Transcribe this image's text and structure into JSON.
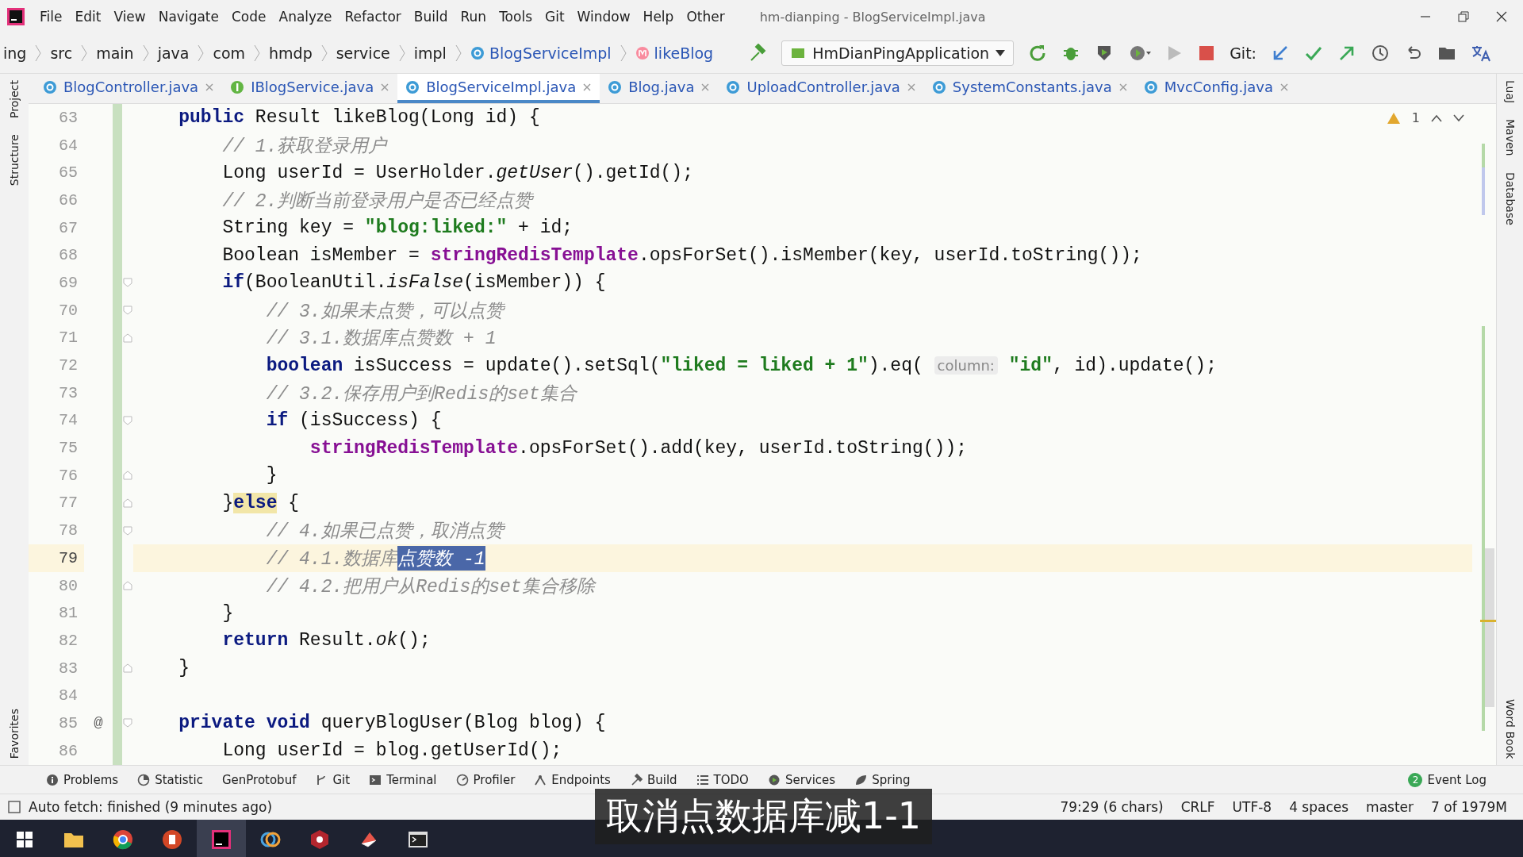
{
  "title_bar": {
    "menu": [
      "File",
      "Edit",
      "View",
      "Navigate",
      "Code",
      "Analyze",
      "Refactor",
      "Build",
      "Run",
      "Tools",
      "Git",
      "Window",
      "Help",
      "Other"
    ],
    "title": "hm-dianping - BlogServiceImpl.java"
  },
  "nav_bar": {
    "breadcrumbs": [
      {
        "text": "ing",
        "kind": "folder"
      },
      {
        "text": "src",
        "kind": "folder"
      },
      {
        "text": "main",
        "kind": "folder"
      },
      {
        "text": "java",
        "kind": "folder"
      },
      {
        "text": "com",
        "kind": "folder"
      },
      {
        "text": "hmdp",
        "kind": "folder"
      },
      {
        "text": "service",
        "kind": "folder"
      },
      {
        "text": "impl",
        "kind": "folder"
      },
      {
        "text": "BlogServiceImpl",
        "kind": "class"
      },
      {
        "text": "likeBlog",
        "kind": "method"
      }
    ],
    "run_config": "HmDianPingApplication",
    "git_label": "Git:"
  },
  "tabs": [
    {
      "label": "BlogController.java",
      "kind": "class",
      "selected": false
    },
    {
      "label": "IBlogService.java",
      "kind": "interface",
      "selected": false
    },
    {
      "label": "BlogServiceImpl.java",
      "kind": "class",
      "selected": true
    },
    {
      "label": "Blog.java",
      "kind": "class",
      "selected": false
    },
    {
      "label": "UploadController.java",
      "kind": "class",
      "selected": false
    },
    {
      "label": "SystemConstants.java",
      "kind": "class",
      "selected": false
    },
    {
      "label": "MvcConfig.java",
      "kind": "class",
      "selected": false
    }
  ],
  "left_strip": {
    "top": [
      "Project",
      "Structure"
    ],
    "bottom": [
      "Favorites"
    ]
  },
  "right_strip": {
    "top": [
      "LuaJ",
      "Maven",
      "Database"
    ],
    "bottom": [
      "Word Book"
    ]
  },
  "editor": {
    "warning_count": "1",
    "lines": [
      {
        "number": "63",
        "kind": "plain",
        "current": false,
        "tokens": [
          {
            "kind": "keyword",
            "text": "    public "
          },
          {
            "kind": "plain",
            "text": "Result likeBlog(Long id) {"
          }
        ]
      },
      {
        "number": "64",
        "kind": "plain",
        "current": false,
        "tokens": [
          {
            "kind": "comment",
            "text": "        // 1.获取登录用户"
          }
        ]
      },
      {
        "number": "65",
        "kind": "plain",
        "current": false,
        "tokens": [
          {
            "kind": "plain",
            "text": "        Long userId = UserHolder."
          },
          {
            "kind": "italic",
            "text": "getUser"
          },
          {
            "kind": "plain",
            "text": "().getId();"
          }
        ]
      },
      {
        "number": "66",
        "kind": "plain",
        "current": false,
        "tokens": [
          {
            "kind": "comment",
            "text": "        // 2.判断当前登录用户是否已经点赞"
          }
        ]
      },
      {
        "number": "67",
        "kind": "plain",
        "current": false,
        "tokens": [
          {
            "kind": "plain",
            "text": "        String key = "
          },
          {
            "kind": "string",
            "text": "\"blog:liked:\""
          },
          {
            "kind": "plain",
            "text": " + id;"
          }
        ]
      },
      {
        "number": "68",
        "kind": "plain",
        "current": false,
        "tokens": [
          {
            "kind": "plain",
            "text": "        Boolean isMember = "
          },
          {
            "kind": "field",
            "text": "stringRedisTemplate"
          },
          {
            "kind": "plain",
            "text": ".opsForSet().isMember(key, userId.toString());"
          }
        ]
      },
      {
        "number": "69",
        "kind": "fold-start",
        "current": false,
        "tokens": [
          {
            "kind": "keyword",
            "text": "        if"
          },
          {
            "kind": "plain",
            "text": "(BooleanUtil."
          },
          {
            "kind": "italic",
            "text": "isFalse"
          },
          {
            "kind": "plain",
            "text": "(isMember)) {"
          }
        ]
      },
      {
        "number": "70",
        "kind": "fold-start",
        "current": false,
        "tokens": [
          {
            "kind": "comment",
            "text": "            // 3.如果未点赞，可以点赞"
          }
        ]
      },
      {
        "number": "71",
        "kind": "fold-end",
        "current": false,
        "tokens": [
          {
            "kind": "comment",
            "text": "            // 3.1.数据库点赞数 + 1"
          }
        ]
      },
      {
        "number": "72",
        "kind": "plain",
        "current": false,
        "tokens": [
          {
            "kind": "keyword",
            "text": "            boolean "
          },
          {
            "kind": "plain",
            "text": "isSuccess = update().setSql("
          },
          {
            "kind": "string",
            "text": "\"liked = liked + 1\""
          },
          {
            "kind": "plain",
            "text": ").eq( "
          },
          {
            "kind": "hint",
            "text": "column:"
          },
          {
            "kind": "string",
            "text": " \"id\""
          },
          {
            "kind": "plain",
            "text": ", id).update();"
          }
        ]
      },
      {
        "number": "73",
        "kind": "plain",
        "current": false,
        "tokens": [
          {
            "kind": "comment",
            "text": "            // 3.2.保存用户到Redis的set集合"
          }
        ]
      },
      {
        "number": "74",
        "kind": "fold-start",
        "current": false,
        "tokens": [
          {
            "kind": "keyword",
            "text": "            if "
          },
          {
            "kind": "plain",
            "text": "(isSuccess) {"
          }
        ]
      },
      {
        "number": "75",
        "kind": "plain",
        "current": false,
        "tokens": [
          {
            "kind": "field",
            "text": "                stringRedisTemplate"
          },
          {
            "kind": "plain",
            "text": ".opsForSet().add(key, userId.toString());"
          }
        ]
      },
      {
        "number": "76",
        "kind": "fold-end",
        "current": false,
        "tokens": [
          {
            "kind": "plain",
            "text": "            }"
          }
        ]
      },
      {
        "number": "77",
        "kind": "fold-end",
        "current": false,
        "tokens": [
          {
            "kind": "plain",
            "text": "        }"
          },
          {
            "kind": "keyword-match",
            "text": "else"
          },
          {
            "kind": "plain",
            "text": " {"
          }
        ]
      },
      {
        "number": "78",
        "kind": "fold-start",
        "current": false,
        "tokens": [
          {
            "kind": "comment",
            "text": "            // 4.如果已点赞，取消点赞"
          }
        ]
      },
      {
        "number": "79",
        "kind": "plain",
        "current": true,
        "tokens": [
          {
            "kind": "comment",
            "text": "            // 4.1.数据库"
          },
          {
            "kind": "selection",
            "text": "点赞数 -1"
          }
        ]
      },
      {
        "number": "80",
        "kind": "fold-end",
        "current": false,
        "tokens": [
          {
            "kind": "comment",
            "text": "            // 4.2.把用户从Redis的set集合移除"
          }
        ]
      },
      {
        "number": "81",
        "kind": "plain",
        "current": false,
        "tokens": [
          {
            "kind": "plain",
            "text": "        }"
          }
        ]
      },
      {
        "number": "82",
        "kind": "plain",
        "current": false,
        "tokens": [
          {
            "kind": "keyword",
            "text": "        return "
          },
          {
            "kind": "plain",
            "text": "Result."
          },
          {
            "kind": "italic",
            "text": "ok"
          },
          {
            "kind": "plain",
            "text": "();"
          }
        ]
      },
      {
        "number": "83",
        "kind": "fold-end",
        "current": false,
        "tokens": [
          {
            "kind": "plain",
            "text": "    }"
          }
        ]
      },
      {
        "number": "84",
        "kind": "plain",
        "current": false
      },
      {
        "number": "85",
        "kind": "fold-start",
        "current": false,
        "annotation": "@",
        "tokens": [
          {
            "kind": "keyword",
            "text": "    private void "
          },
          {
            "kind": "plain",
            "text": "queryBlogUser(Blog blog) {"
          }
        ]
      },
      {
        "number": "86",
        "kind": "plain",
        "current": false,
        "tokens": [
          {
            "kind": "plain",
            "text": "        Long userId = blog.getUserId();"
          }
        ]
      }
    ]
  },
  "tool_windows": [
    {
      "label": "Problems",
      "kind": "problems"
    },
    {
      "label": "Statistic",
      "kind": "statistic"
    },
    {
      "label": "GenProtobuf",
      "kind": "none"
    },
    {
      "label": "Git",
      "kind": "git"
    },
    {
      "label": "Terminal",
      "kind": "terminal"
    },
    {
      "label": "Profiler",
      "kind": "profiler"
    },
    {
      "label": "Endpoints",
      "kind": "endpoints"
    },
    {
      "label": "Build",
      "kind": "build"
    },
    {
      "label": "TODO",
      "kind": "todo"
    },
    {
      "label": "Services",
      "kind": "services"
    },
    {
      "label": "Spring",
      "kind": "spring"
    }
  ],
  "event_log": {
    "label": "Event Log",
    "badge": "2"
  },
  "status_bar": {
    "message": "Auto fetch: finished (9 minutes ago)",
    "items": [
      "79:29 (6 chars)",
      "CRLF",
      "UTF-8",
      "4 spaces",
      "master",
      "7 of 1979M"
    ]
  },
  "subtitle": "取消点数据库减1-1"
}
